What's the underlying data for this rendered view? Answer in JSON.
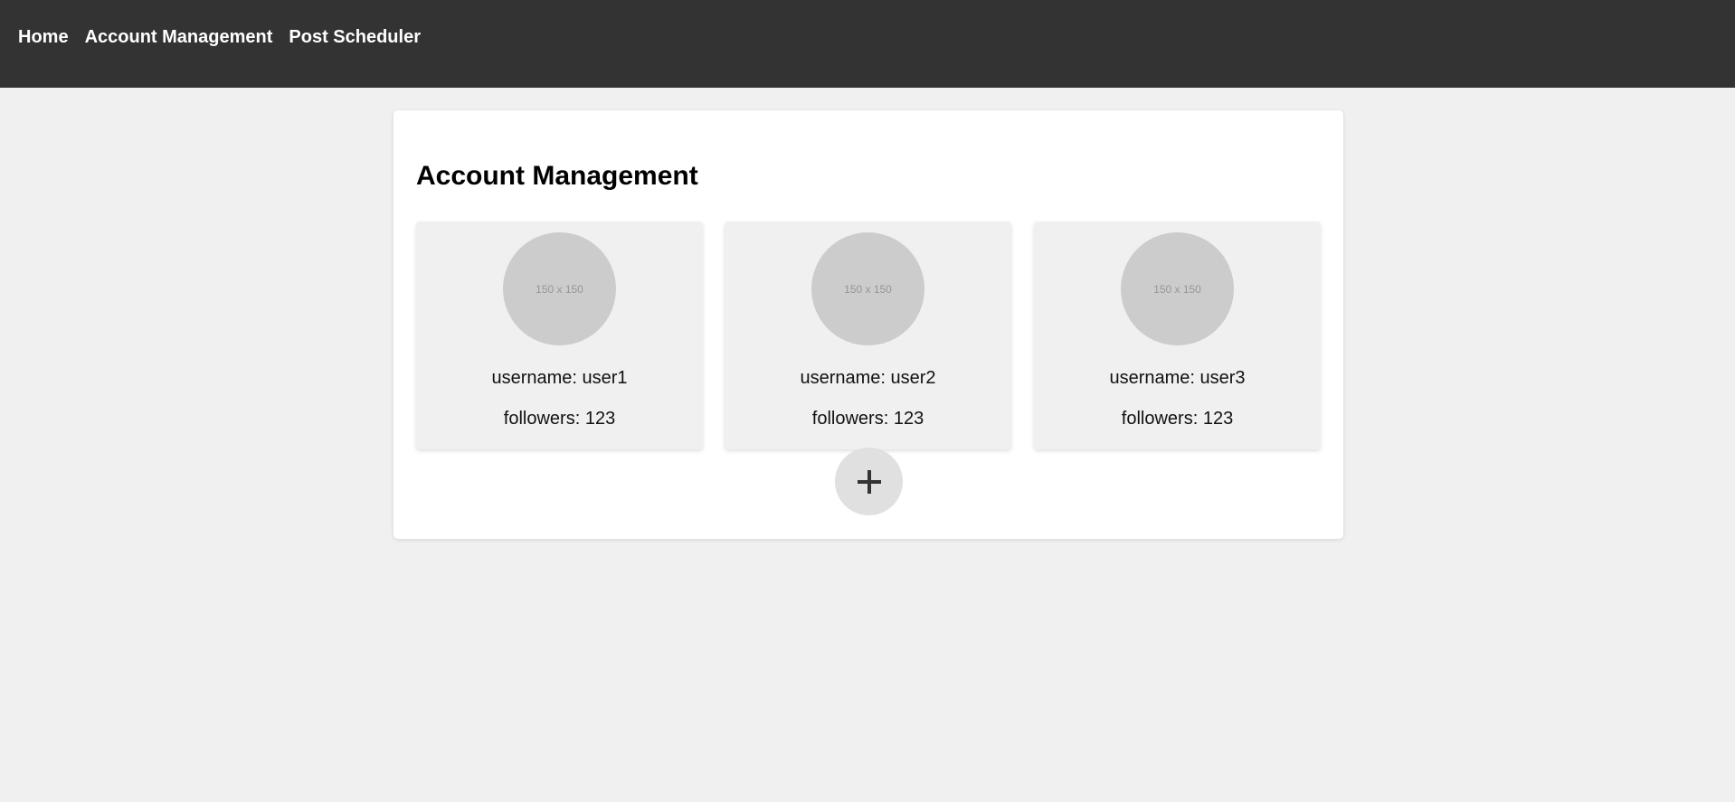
{
  "nav": {
    "items": [
      {
        "label": "Home"
      },
      {
        "label": "Account Management"
      },
      {
        "label": "Post Scheduler"
      }
    ]
  },
  "main": {
    "title": "Account Management",
    "accounts": [
      {
        "avatar_text": "150 x 150",
        "username": "username: user1",
        "followers": "followers: 123"
      },
      {
        "avatar_text": "150 x 150",
        "username": "username: user2",
        "followers": "followers: 123"
      },
      {
        "avatar_text": "150 x 150",
        "username": "username: user3",
        "followers": "followers: 123"
      }
    ],
    "add_button_icon": "plus-icon"
  },
  "colors": {
    "topbar": "#333333",
    "background": "#f0f0f0",
    "panel": "#ffffff",
    "avatar": "#cccccc",
    "add_button": "#e0e0e0"
  }
}
